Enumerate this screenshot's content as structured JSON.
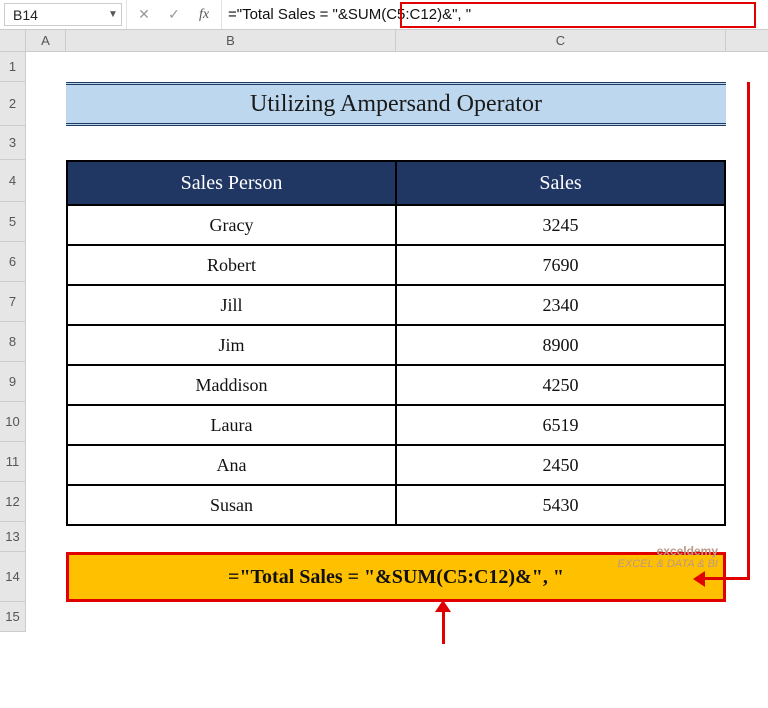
{
  "namebox": {
    "value": "B14"
  },
  "formula_bar": {
    "formula": "=\"Total Sales = \"&SUM(C5:C12)&\", \""
  },
  "columns": {
    "A": "A",
    "B": "B",
    "C": "C"
  },
  "rows": [
    "1",
    "2",
    "3",
    "4",
    "5",
    "6",
    "7",
    "8",
    "9",
    "10",
    "11",
    "12",
    "13",
    "14",
    "15"
  ],
  "title": "Utilizing Ampersand Operator",
  "table": {
    "headers": {
      "person": "Sales Person",
      "sales": "Sales"
    },
    "rows": [
      {
        "person": "Gracy",
        "sales": "3245"
      },
      {
        "person": "Robert",
        "sales": "7690"
      },
      {
        "person": "Jill",
        "sales": "2340"
      },
      {
        "person": "Jim",
        "sales": "8900"
      },
      {
        "person": "Maddison",
        "sales": "4250"
      },
      {
        "person": "Laura",
        "sales": "6519"
      },
      {
        "person": "Ana",
        "sales": "2450"
      },
      {
        "person": "Susan",
        "sales": "5430"
      }
    ]
  },
  "formula_cell": {
    "display": "=\"Total Sales = \"&SUM(C5:C12)&\", \""
  },
  "watermark": {
    "brand": "exceldemy",
    "tag": "EXCEL & DATA & BI"
  },
  "chart_data": {
    "type": "table",
    "title": "Utilizing Ampersand Operator",
    "columns": [
      "Sales Person",
      "Sales"
    ],
    "rows": [
      [
        "Gracy",
        3245
      ],
      [
        "Robert",
        7690
      ],
      [
        "Jill",
        2340
      ],
      [
        "Jim",
        8900
      ],
      [
        "Maddison",
        4250
      ],
      [
        "Laura",
        6519
      ],
      [
        "Ana",
        2450
      ],
      [
        "Susan",
        5430
      ]
    ],
    "formula": "=\"Total Sales = \"&SUM(C5:C12)&\", \""
  }
}
